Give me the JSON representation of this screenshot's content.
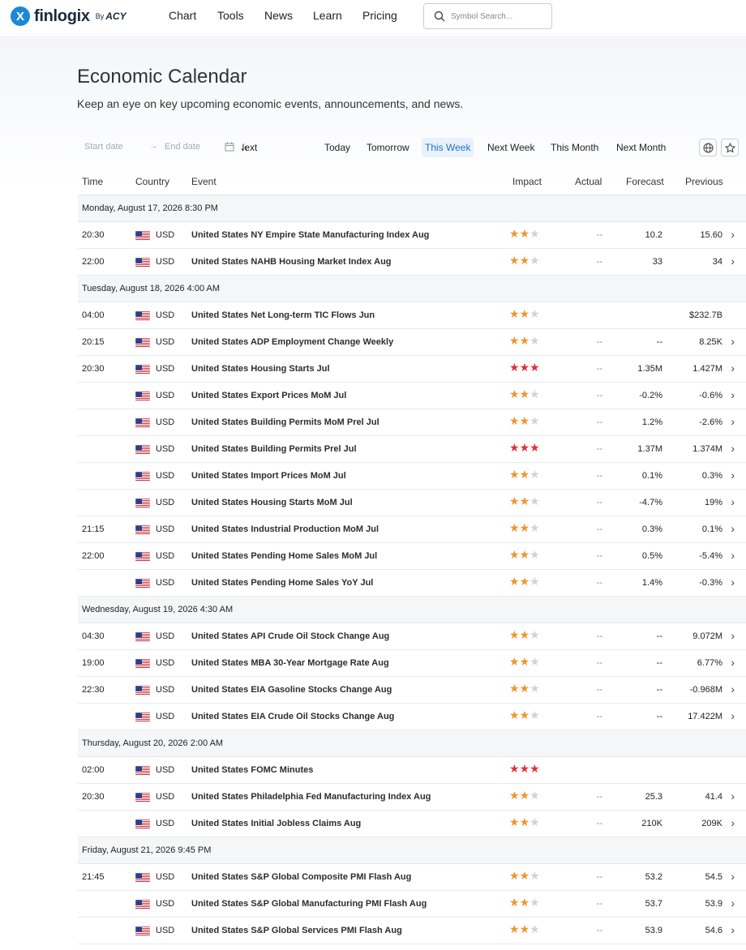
{
  "brand": {
    "name": "finlogix",
    "by": "By",
    "partner": "ACY",
    "mark": "X"
  },
  "nav": [
    {
      "label": "Chart"
    },
    {
      "label": "Tools"
    },
    {
      "label": "News"
    },
    {
      "label": "Learn"
    },
    {
      "label": "Pricing"
    }
  ],
  "search": {
    "placeholder": "Symbol Search..."
  },
  "page": {
    "title": "Economic Calendar",
    "subtitle": "Keep an eye on key upcoming economic events, announcements, and news."
  },
  "filters": {
    "start_placeholder": "Start date",
    "end_placeholder": "End date",
    "periods": [
      {
        "label": "Recent & Next",
        "active": false
      },
      {
        "label": "Today",
        "active": false
      },
      {
        "label": "Tomorrow",
        "active": false
      },
      {
        "label": "This Week",
        "active": true
      },
      {
        "label": "Next Week",
        "active": false
      },
      {
        "label": "This Month",
        "active": false
      },
      {
        "label": "Next Month",
        "active": false
      }
    ]
  },
  "colors": {
    "accent": "#1a73d0",
    "star_medium": "#f0952a",
    "star_high": "#e0303a",
    "star_off": "#cfd3d8"
  },
  "columns": {
    "time": "Time",
    "country": "Country",
    "event": "Event",
    "impact": "Impact",
    "actual": "Actual",
    "forecast": "Forecast",
    "previous": "Previous"
  },
  "days": [
    {
      "label": "Monday, August 17, 2026 8:30 PM",
      "events": [
        {
          "time": "20:30",
          "country": "USD",
          "event": "United States NY Empire State Manufacturing Index Aug",
          "impact": 2,
          "actual": "--",
          "forecast": "10.2",
          "previous": "15.60",
          "chevron": true
        },
        {
          "time": "22:00",
          "country": "USD",
          "event": "United States NAHB Housing Market Index Aug",
          "impact": 2,
          "actual": "--",
          "forecast": "33",
          "previous": "34",
          "chevron": true
        }
      ]
    },
    {
      "label": "Tuesday, August 18, 2026 4:00 AM",
      "events": [
        {
          "time": "04:00",
          "country": "USD",
          "event": "United States Net Long-term TIC Flows Jun",
          "impact": 2,
          "actual": "",
          "forecast": "",
          "previous": "$232.7B",
          "chevron": false
        },
        {
          "time": "20:15",
          "country": "USD",
          "event": "United States ADP Employment Change Weekly",
          "impact": 2,
          "actual": "--",
          "forecast": "--",
          "previous": "8.25K",
          "chevron": true
        },
        {
          "time": "20:30",
          "country": "USD",
          "event": "United States Housing Starts Jul",
          "impact": 3,
          "actual": "--",
          "forecast": "1.35M",
          "previous": "1.427M",
          "chevron": true
        },
        {
          "time": "",
          "country": "USD",
          "event": "United States Export Prices MoM Jul",
          "impact": 2,
          "actual": "--",
          "forecast": "-0.2%",
          "previous": "-0.6%",
          "chevron": true
        },
        {
          "time": "",
          "country": "USD",
          "event": "United States Building Permits MoM Prel Jul",
          "impact": 2,
          "actual": "--",
          "forecast": "1.2%",
          "previous": "-2.6%",
          "chevron": true
        },
        {
          "time": "",
          "country": "USD",
          "event": "United States Building Permits Prel Jul",
          "impact": 3,
          "actual": "--",
          "forecast": "1.37M",
          "previous": "1.374M",
          "chevron": true
        },
        {
          "time": "",
          "country": "USD",
          "event": "United States Import Prices MoM Jul",
          "impact": 2,
          "actual": "--",
          "forecast": "0.1%",
          "previous": "0.3%",
          "chevron": true
        },
        {
          "time": "",
          "country": "USD",
          "event": "United States Housing Starts MoM Jul",
          "impact": 2,
          "actual": "--",
          "forecast": "-4.7%",
          "previous": "19%",
          "chevron": true
        },
        {
          "time": "21:15",
          "country": "USD",
          "event": "United States Industrial Production MoM Jul",
          "impact": 2,
          "actual": "--",
          "forecast": "0.3%",
          "previous": "0.1%",
          "chevron": true
        },
        {
          "time": "22:00",
          "country": "USD",
          "event": "United States Pending Home Sales MoM Jul",
          "impact": 2,
          "actual": "--",
          "forecast": "0.5%",
          "previous": "-5.4%",
          "chevron": true
        },
        {
          "time": "",
          "country": "USD",
          "event": "United States Pending Home Sales YoY Jul",
          "impact": 2,
          "actual": "--",
          "forecast": "1.4%",
          "previous": "-0.3%",
          "chevron": true
        }
      ]
    },
    {
      "label": "Wednesday, August 19, 2026 4:30 AM",
      "events": [
        {
          "time": "04:30",
          "country": "USD",
          "event": "United States API Crude Oil Stock Change Aug",
          "impact": 2,
          "actual": "--",
          "forecast": "--",
          "previous": "9.072M",
          "chevron": true
        },
        {
          "time": "19:00",
          "country": "USD",
          "event": "United States MBA 30-Year Mortgage Rate Aug",
          "impact": 2,
          "actual": "--",
          "forecast": "--",
          "previous": "6.77%",
          "chevron": true
        },
        {
          "time": "22:30",
          "country": "USD",
          "event": "United States EIA Gasoline Stocks Change Aug",
          "impact": 2,
          "actual": "--",
          "forecast": "--",
          "previous": "-0.968M",
          "chevron": true
        },
        {
          "time": "",
          "country": "USD",
          "event": "United States EIA Crude Oil Stocks Change Aug",
          "impact": 2,
          "actual": "--",
          "forecast": "--",
          "previous": "17.422M",
          "chevron": true
        }
      ]
    },
    {
      "label": "Thursday, August 20, 2026 2:00 AM",
      "events": [
        {
          "time": "02:00",
          "country": "USD",
          "event": "United States FOMC Minutes",
          "impact": 3,
          "actual": "",
          "forecast": "",
          "previous": "",
          "chevron": false
        },
        {
          "time": "20:30",
          "country": "USD",
          "event": "United States Philadelphia Fed Manufacturing Index Aug",
          "impact": 2,
          "actual": "--",
          "forecast": "25.3",
          "previous": "41.4",
          "chevron": true
        },
        {
          "time": "",
          "country": "USD",
          "event": "United States Initial Jobless Claims Aug",
          "impact": 2,
          "actual": "--",
          "forecast": "210K",
          "previous": "209K",
          "chevron": true
        }
      ]
    },
    {
      "label": "Friday, August 21, 2026 9:45 PM",
      "events": [
        {
          "time": "21:45",
          "country": "USD",
          "event": "United States S&P Global Composite PMI Flash Aug",
          "impact": 2,
          "actual": "--",
          "forecast": "53.2",
          "previous": "54.5",
          "chevron": true
        },
        {
          "time": "",
          "country": "USD",
          "event": "United States S&P Global Manufacturing PMI Flash Aug",
          "impact": 2,
          "actual": "--",
          "forecast": "53.7",
          "previous": "53.9",
          "chevron": true
        },
        {
          "time": "",
          "country": "USD",
          "event": "United States S&P Global Services PMI Flash Aug",
          "impact": 2,
          "actual": "--",
          "forecast": "53.9",
          "previous": "54.6",
          "chevron": true
        }
      ]
    }
  ]
}
